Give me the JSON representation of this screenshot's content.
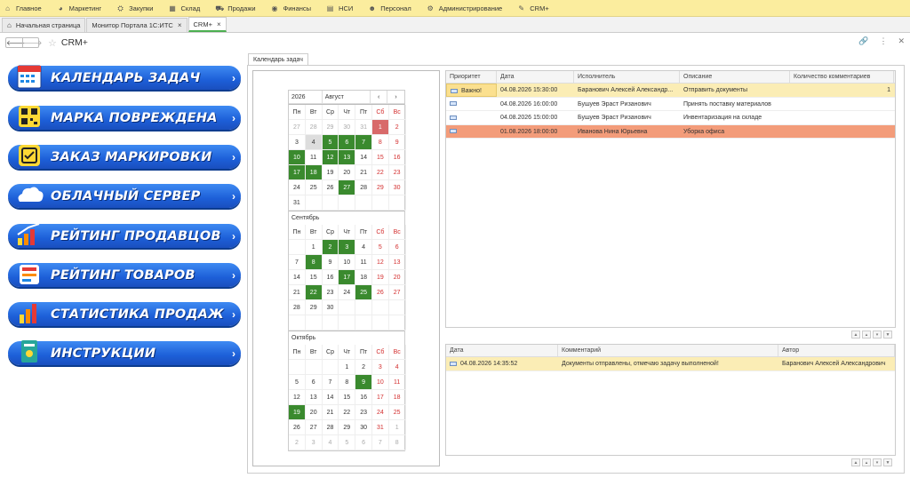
{
  "menu": [
    {
      "icon": "home-icon",
      "glyph": "⌂",
      "label": "Главное"
    },
    {
      "icon": "marketing-icon",
      "glyph": "◕",
      "label": "Маркетинг"
    },
    {
      "icon": "purchases-icon",
      "glyph": "⛭",
      "label": "Закупки"
    },
    {
      "icon": "warehouse-icon",
      "glyph": "▦",
      "label": "Склад"
    },
    {
      "icon": "sales-icon",
      "glyph": "⛟",
      "label": "Продажи"
    },
    {
      "icon": "finance-icon",
      "glyph": "◉",
      "label": "Финансы"
    },
    {
      "icon": "nsi-icon",
      "glyph": "▤",
      "label": "НСИ"
    },
    {
      "icon": "personnel-icon",
      "glyph": "☻",
      "label": "Персонал"
    },
    {
      "icon": "admin-icon",
      "glyph": "⚙",
      "label": "Администрирование"
    },
    {
      "icon": "crm-icon",
      "glyph": "✎",
      "label": "CRM+"
    }
  ],
  "tabs": [
    {
      "label": "Начальная страница",
      "home": true,
      "close": false
    },
    {
      "label": "Монитор Портала 1С:ИТС",
      "close": true
    },
    {
      "label": "CRM+",
      "close": true,
      "active": true
    }
  ],
  "page": {
    "title": "CRM+"
  },
  "banners": [
    {
      "label": "КАЛЕНДАРЬ ЗАДАЧ",
      "icon": "calendar-icon"
    },
    {
      "label": "МАРКА ПОВРЕЖДЕНА",
      "icon": "qr-code-icon"
    },
    {
      "label": "ЗАКАЗ МАРКИРОВКИ",
      "icon": "check-scan-icon"
    },
    {
      "label": "ОБЛАЧНЫЙ СЕРВЕР",
      "icon": "cloud-icon"
    },
    {
      "label": "РЕЙТИНГ ПРОДАВЦОВ",
      "icon": "growth-chart-icon"
    },
    {
      "label": "РЕЙТИНГ ТОВАРОВ",
      "icon": "products-icon"
    },
    {
      "label": "СТАТИСТИКА ПРОДАЖ",
      "icon": "bar-chart-icon"
    },
    {
      "label": "ИНСТРУКЦИИ",
      "icon": "manual-icon"
    }
  ],
  "panel_tab": "Календарь задач",
  "calendar": {
    "year": "2026",
    "month": "Август",
    "weekdays": [
      "Пн",
      "Вт",
      "Ср",
      "Чт",
      "Пт",
      "Сб",
      "Вс"
    ],
    "months": [
      {
        "name": "",
        "days": [
          [
            "27",
            "o"
          ],
          [
            "28",
            "o"
          ],
          [
            "29",
            "o"
          ],
          [
            "30",
            "o"
          ],
          [
            "31",
            "o"
          ],
          [
            "1",
            "r"
          ],
          [
            "2",
            "we"
          ],
          [
            "3",
            ""
          ],
          [
            "4",
            "s"
          ],
          [
            "5",
            "g"
          ],
          [
            "6",
            "g"
          ],
          [
            "7",
            "g"
          ],
          [
            "8",
            "we"
          ],
          [
            "9",
            "we"
          ],
          [
            "10",
            "g"
          ],
          [
            "11",
            ""
          ],
          [
            "12",
            "g"
          ],
          [
            "13",
            "g"
          ],
          [
            "14",
            ""
          ],
          [
            "15",
            "we"
          ],
          [
            "16",
            "we"
          ],
          [
            "17",
            "g"
          ],
          [
            "18",
            "g"
          ],
          [
            "19",
            ""
          ],
          [
            "20",
            ""
          ],
          [
            "21",
            ""
          ],
          [
            "22",
            "we"
          ],
          [
            "23",
            "we"
          ],
          [
            "24",
            ""
          ],
          [
            "25",
            ""
          ],
          [
            "26",
            ""
          ],
          [
            "27",
            "g"
          ],
          [
            "28",
            ""
          ],
          [
            "29",
            "we"
          ],
          [
            "30",
            "we"
          ],
          [
            "31",
            ""
          ],
          [
            "",
            ""
          ],
          [
            "",
            ""
          ],
          [
            "",
            ""
          ],
          [
            "",
            ""
          ],
          [
            "",
            ""
          ],
          [
            "",
            ""
          ]
        ]
      },
      {
        "name": "Сентябрь",
        "days": [
          [
            "",
            ""
          ],
          [
            "1",
            ""
          ],
          [
            "2",
            "g"
          ],
          [
            "3",
            "g"
          ],
          [
            "4",
            ""
          ],
          [
            "5",
            "we"
          ],
          [
            "6",
            "we"
          ],
          [
            "7",
            ""
          ],
          [
            "8",
            "g"
          ],
          [
            "9",
            ""
          ],
          [
            "10",
            ""
          ],
          [
            "11",
            ""
          ],
          [
            "12",
            "we"
          ],
          [
            "13",
            "we"
          ],
          [
            "14",
            ""
          ],
          [
            "15",
            ""
          ],
          [
            "16",
            ""
          ],
          [
            "17",
            "g"
          ],
          [
            "18",
            ""
          ],
          [
            "19",
            "we"
          ],
          [
            "20",
            "we"
          ],
          [
            "21",
            ""
          ],
          [
            "22",
            "g"
          ],
          [
            "23",
            ""
          ],
          [
            "24",
            ""
          ],
          [
            "25",
            "g"
          ],
          [
            "26",
            "we"
          ],
          [
            "27",
            "we"
          ],
          [
            "28",
            ""
          ],
          [
            "29",
            ""
          ],
          [
            "30",
            ""
          ],
          [
            "",
            ""
          ],
          [
            "",
            ""
          ],
          [
            "",
            ""
          ],
          [
            "",
            ""
          ],
          [
            "",
            ""
          ],
          [
            "",
            ""
          ],
          [
            "",
            ""
          ],
          [
            "",
            ""
          ],
          [
            "",
            ""
          ],
          [
            "",
            ""
          ],
          [
            "",
            ""
          ]
        ]
      },
      {
        "name": "Октябрь",
        "days": [
          [
            "",
            ""
          ],
          [
            "",
            ""
          ],
          [
            "",
            ""
          ],
          [
            "1",
            ""
          ],
          [
            "2",
            ""
          ],
          [
            "3",
            "we"
          ],
          [
            "4",
            "we"
          ],
          [
            "5",
            ""
          ],
          [
            "6",
            ""
          ],
          [
            "7",
            ""
          ],
          [
            "8",
            ""
          ],
          [
            "9",
            "g"
          ],
          [
            "10",
            "we"
          ],
          [
            "11",
            "we"
          ],
          [
            "12",
            ""
          ],
          [
            "13",
            ""
          ],
          [
            "14",
            ""
          ],
          [
            "15",
            ""
          ],
          [
            "16",
            ""
          ],
          [
            "17",
            "we"
          ],
          [
            "18",
            "we"
          ],
          [
            "19",
            "g"
          ],
          [
            "20",
            ""
          ],
          [
            "21",
            ""
          ],
          [
            "22",
            ""
          ],
          [
            "23",
            ""
          ],
          [
            "24",
            "we"
          ],
          [
            "25",
            "we"
          ],
          [
            "26",
            ""
          ],
          [
            "27",
            ""
          ],
          [
            "28",
            ""
          ],
          [
            "29",
            ""
          ],
          [
            "30",
            ""
          ],
          [
            "31",
            "we"
          ],
          [
            "1",
            "o"
          ],
          [
            "2",
            "o"
          ],
          [
            "3",
            "o"
          ],
          [
            "4",
            "o"
          ],
          [
            "5",
            "o"
          ],
          [
            "6",
            "o"
          ],
          [
            "7",
            "o"
          ],
          [
            "8",
            "o"
          ]
        ]
      }
    ]
  },
  "tasks": {
    "headers": [
      "Приоритет",
      "Дата",
      "Исполнитель",
      "Описание",
      "Количество комментариев"
    ],
    "rows": [
      {
        "priority": "Важно!",
        "date": "04.08.2026 15:30:00",
        "executor": "Баранович Алексей Александр...",
        "desc": "Отправить документы",
        "count": "1",
        "style": "y"
      },
      {
        "priority": "",
        "date": "04.08.2026 16:00:00",
        "executor": "Бушуев Эраст Ризанович",
        "desc": "Принять поставку материалов",
        "count": "",
        "style": ""
      },
      {
        "priority": "",
        "date": "04.08.2026 15:00:00",
        "executor": "Бушуев Эраст Ризанович",
        "desc": "Инвентаризация на складе",
        "count": "",
        "style": ""
      },
      {
        "priority": "",
        "date": "01.08.2026 18:00:00",
        "executor": "Иванова Нина Юрьевна",
        "desc": "Уборка офиса",
        "count": "",
        "style": "o"
      }
    ]
  },
  "comments": {
    "headers": [
      "Дата",
      "Комментарий",
      "Автор"
    ],
    "rows": [
      {
        "date": "04.08.2026 14:35:52",
        "text": "Документы отправлены, отмечаю задачу выполненой!",
        "author": "Баранович Алексей Александрович"
      }
    ]
  }
}
